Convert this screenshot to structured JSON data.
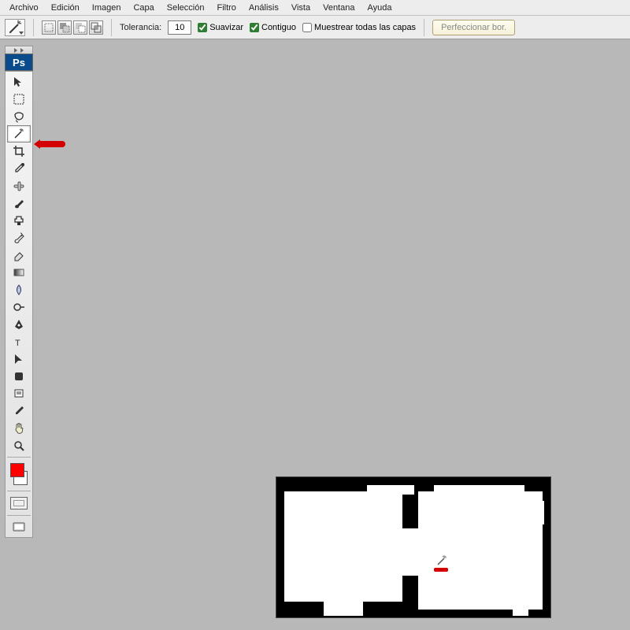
{
  "menu": {
    "items": [
      "Archivo",
      "Edición",
      "Imagen",
      "Capa",
      "Selección",
      "Filtro",
      "Análisis",
      "Vista",
      "Ventana",
      "Ayuda"
    ]
  },
  "options": {
    "tolerance_label": "Tolerancia:",
    "tolerance_value": "10",
    "antialias_label": "Suavizar",
    "antialias_checked": true,
    "contiguous_label": "Contiguo",
    "contiguous_checked": true,
    "sample_all_label": "Muestrear todas las capas",
    "sample_all_checked": false,
    "refine_label": "Perfeccionar bor."
  },
  "toolbox": {
    "logo": "Ps",
    "tools": [
      {
        "name": "move-tool"
      },
      {
        "name": "marquee-tool"
      },
      {
        "name": "lasso-tool"
      },
      {
        "name": "magic-wand-tool",
        "selected": true
      },
      {
        "name": "crop-tool"
      },
      {
        "name": "eyedropper-tool"
      },
      {
        "name": "healing-brush-tool"
      },
      {
        "name": "brush-tool"
      },
      {
        "name": "clone-stamp-tool"
      },
      {
        "name": "history-brush-tool"
      },
      {
        "name": "eraser-tool"
      },
      {
        "name": "gradient-tool"
      },
      {
        "name": "blur-tool"
      },
      {
        "name": "dodge-tool"
      },
      {
        "name": "pen-tool"
      },
      {
        "name": "type-tool"
      },
      {
        "name": "path-selection-tool"
      },
      {
        "name": "shape-tool"
      },
      {
        "name": "notes-tool"
      },
      {
        "name": "color-sampler-tool"
      },
      {
        "name": "hand-tool"
      },
      {
        "name": "zoom-tool"
      }
    ],
    "colors": {
      "foreground": "#ff0000",
      "background": "#ffffff"
    }
  }
}
